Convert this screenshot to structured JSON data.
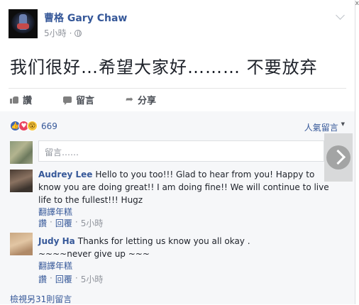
{
  "post": {
    "author": "曹格 Gary Chaw",
    "time": "5小時",
    "separator": "·",
    "text": "我们很好…希望大家好……… 不要放弃"
  },
  "actions": {
    "like": "讚",
    "comment": "留言",
    "share": "分享"
  },
  "reactions": {
    "count": "669",
    "like_glyph": "👍",
    "love_glyph": "♥",
    "wow_glyph": "😮"
  },
  "sort": {
    "label": "人氣留言",
    "arrow": "▼"
  },
  "composer": {
    "placeholder": "留言……"
  },
  "comments": [
    {
      "author": "Audrey Lee",
      "text": "Hello to you too!!! Glad to hear from you! Happy to know you are doing great!! I am doing fine!! We will continue to live life to the fullest!!! Hugz",
      "translate": "翻譯年糕",
      "like": "讚",
      "reply": "回覆",
      "dot": "·",
      "time": "5小時"
    },
    {
      "author": "Judy Ha",
      "text_line1": "Thanks for letting us know you all okay .",
      "text_line2": "~~~~never give up ~~~",
      "translate": "翻譯年糕",
      "like": "讚",
      "reply": "回覆",
      "dot": "·",
      "time": "5小時"
    }
  ],
  "more_comments": "檢視另31則留言",
  "window": {
    "corner": "x"
  },
  "colors": {
    "link": "#365899",
    "meta": "#90949c",
    "text": "#1d2129",
    "like_blue": "#4267b2",
    "love_red": "#e9425f",
    "wow_yellow": "#f7c53c"
  }
}
